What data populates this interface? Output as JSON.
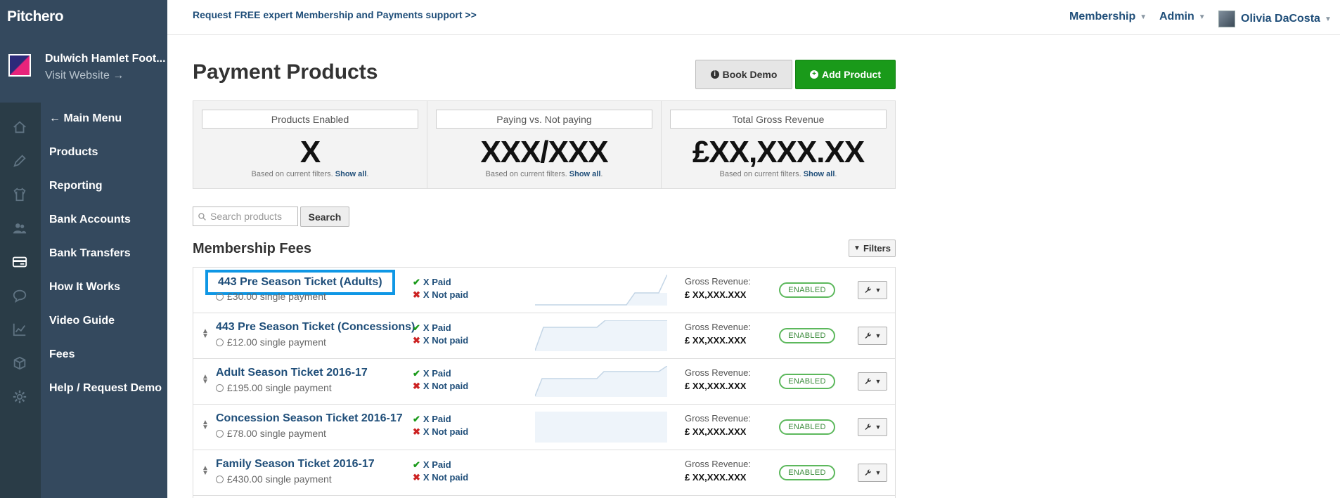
{
  "app": {
    "logo_text": "Pitchero",
    "club_name": "Dulwich Hamlet Foot...",
    "visit_website": "Visit Website →"
  },
  "sidebar": {
    "back_label": "Main Menu",
    "items": [
      {
        "label": "Products",
        "icon": "shirt-icon"
      },
      {
        "label": "Reporting",
        "icon": "people-icon"
      },
      {
        "label": "Bank Accounts",
        "icon": "card-icon"
      },
      {
        "label": "Bank Transfers",
        "icon": "chat-icon"
      },
      {
        "label": "How It Works",
        "icon": "chart-icon"
      },
      {
        "label": "Video Guide",
        "icon": "cube-icon"
      },
      {
        "label": "Fees",
        "icon": "gear-icon"
      },
      {
        "label": "Help / Request Demo"
      }
    ],
    "rail_icons": [
      "home-icon",
      "pencil-icon",
      "shirt-icon",
      "people-icon",
      "card-icon",
      "chat-icon",
      "chart-icon",
      "cube-icon",
      "gear-icon"
    ]
  },
  "topbar": {
    "promo": "Request FREE expert Membership and Payments support >>",
    "membership": "Membership",
    "admin": "Admin",
    "user": "Olivia DaCosta"
  },
  "page": {
    "title": "Payment Products",
    "book_demo": "Book Demo",
    "add_product": "Add Product"
  },
  "stats": [
    {
      "label": "Products Enabled",
      "value": "X"
    },
    {
      "label": "Paying vs. Not paying",
      "value": "XXX/XXX"
    },
    {
      "label": "Total Gross Revenue",
      "value": "£XX,XXX.XX"
    }
  ],
  "stats_note": {
    "text": "Based on current filters.",
    "link": "Show all"
  },
  "search": {
    "placeholder": "Search products",
    "button": "Search"
  },
  "section": {
    "title": "Membership Fees",
    "filters": "Filters"
  },
  "products": [
    {
      "name": "443 Pre Season Ticket (Adults)",
      "price": "£30.00 single payment",
      "paid": "X Paid",
      "not_paid": "X Not paid",
      "gross_label": "Gross Revenue:",
      "gross": "£ XX,XXX.XXX",
      "status": "ENABLED",
      "selected": true
    },
    {
      "name": "443 Pre Season Ticket (Concessions)",
      "price": "£12.00 single payment",
      "paid": "X Paid",
      "not_paid": "X Not paid",
      "gross_label": "Gross Revenue:",
      "gross": "£ XX,XXX.XXX",
      "status": "ENABLED"
    },
    {
      "name": "Adult Season Ticket 2016-17",
      "price": "£195.00 single payment",
      "paid": "X Paid",
      "not_paid": "X Not paid",
      "gross_label": "Gross Revenue:",
      "gross": "£ XX,XXX.XXX",
      "status": "ENABLED"
    },
    {
      "name": "Concession Season Ticket 2016-17",
      "price": "£78.00 single payment",
      "paid": "X Paid",
      "not_paid": "X Not paid",
      "gross_label": "Gross Revenue:",
      "gross": "£ XX,XXX.XXX",
      "status": "ENABLED"
    },
    {
      "name": "Family Season Ticket 2016-17",
      "price": "£430.00 single payment",
      "paid": "X Paid",
      "not_paid": "X Not paid",
      "gross_label": "Gross Revenue:",
      "gross": "£ XX,XXX.XXX",
      "status": "ENABLED"
    }
  ],
  "colors": {
    "sidebar_bg": "#34495e",
    "rail_bg": "#2a3c47",
    "link": "#1f4e79",
    "add_button": "#1a9a1a",
    "enabled_badge": "#5cb85c",
    "selection_box": "#0f97e5"
  }
}
